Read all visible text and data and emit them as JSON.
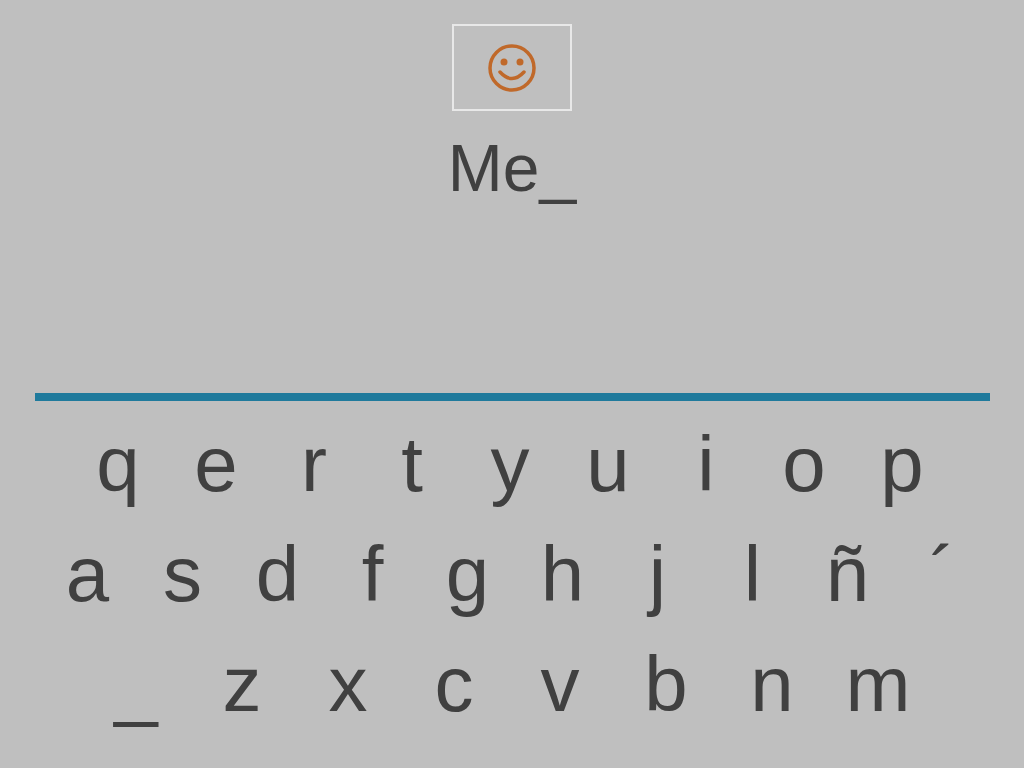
{
  "word": "Me_",
  "keyboard": {
    "rows": [
      [
        "q",
        "e",
        "r",
        "t",
        "y",
        "u",
        "i",
        "o",
        "p"
      ],
      [
        "a",
        "s",
        "d",
        "f",
        "g",
        "h",
        "j",
        "l",
        "ñ",
        "´"
      ],
      [
        "_",
        "z",
        "x",
        "c",
        "v",
        "b",
        "n",
        "m"
      ]
    ]
  }
}
